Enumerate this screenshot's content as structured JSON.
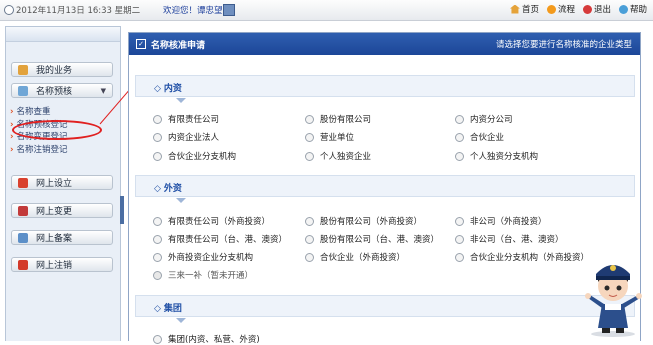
{
  "topbar": {
    "datetime": "2012年11月13日 16:33 星期二",
    "welcome": "欢迎您！谭忠望",
    "links": [
      {
        "label": "首页",
        "icon": "home-icon"
      },
      {
        "label": "流程",
        "icon": "flow-icon"
      },
      {
        "label": "退出",
        "icon": "exit-icon"
      },
      {
        "label": "帮助",
        "icon": "help-icon"
      }
    ]
  },
  "sidebar": {
    "menus": [
      {
        "label": "我的业务",
        "icon": "user-icon"
      },
      {
        "label": "名称预核",
        "icon": "user-icon"
      },
      {
        "label": "网上设立",
        "icon": "flag-icon"
      },
      {
        "label": "网上变更",
        "icon": "check-icon"
      },
      {
        "label": "网上备案",
        "icon": "user-icon"
      },
      {
        "label": "网上注销",
        "icon": "cancel-icon"
      }
    ],
    "submenu": [
      "名称查重",
      "名称预核登记",
      "名称变更登记",
      "名称注销登记"
    ]
  },
  "main": {
    "title": "名称核准申请",
    "hint": "请选择您要进行名称核准的企业类型",
    "sections": [
      {
        "title": "内资",
        "options": [
          "有限责任公司",
          "股份有限公司",
          "内资分公司",
          "内资企业法人",
          "营业单位",
          "合伙企业",
          "合伙企业分支机构",
          "个人独资企业",
          "个人独资分支机构"
        ]
      },
      {
        "title": "外资",
        "options": [
          "有限责任公司（外商投资）",
          "股份有限公司（外商投资）",
          "非公司（外商投资）",
          "有限责任公司（台、港、澳资）",
          "股份有限公司（台、港、澳资）",
          "非公司（台、港、澳资）",
          "外商投资企业分支机构",
          "合伙企业（外商投资）",
          "合伙企业分支机构（外商投资）",
          "三来一补（暂未开通）"
        ]
      },
      {
        "title": "集团",
        "options": [
          "集团(内资、私营、外资)"
        ]
      }
    ]
  },
  "colors": {
    "header_blue": "#1c4698",
    "accent_red": "#e02020",
    "section_blue": "#1f4fa6"
  }
}
